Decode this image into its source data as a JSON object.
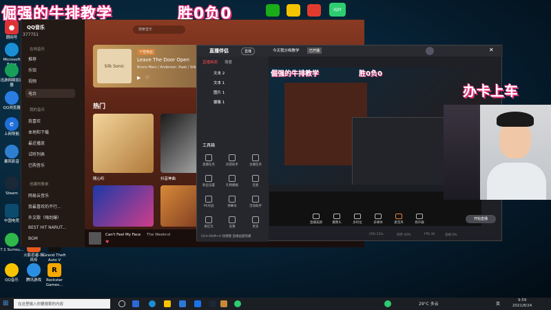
{
  "overlay": {
    "title_left": "倔强的牛排教学",
    "record": "胜0负0",
    "card_banner": "办卡上车"
  },
  "desktop_icons": [
    {
      "label": "朗网号",
      "sub": ""
    },
    {
      "label": "Microsoft Edge",
      "sub": ""
    },
    {
      "label": "迅游网络加速器",
      "sub": ""
    },
    {
      "label": "QQ浏览器",
      "sub": ""
    },
    {
      "label": "上网导航",
      "sub": ""
    },
    {
      "label": "暴风影音",
      "sub": ""
    },
    {
      "label": "Steam",
      "sub": ""
    },
    {
      "label": "中国电竞",
      "sub": ""
    },
    {
      "label": "7.1 Surrou...",
      "sub": ""
    },
    {
      "label": "QQ音乐",
      "sub": ""
    }
  ],
  "bottom_desktop_icons": [
    {
      "label": "火影忍者-疾风传"
    },
    {
      "label": "Grand Theft Auto V"
    },
    {
      "label": "Rockstar Games..."
    },
    {
      "label": "腾讯游戏"
    }
  ],
  "qqmusic": {
    "title": "QQ音乐",
    "user_id": "377751",
    "search_placeholder": "搜索音乐",
    "nav": [
      "推荐",
      "乐馆",
      "视频",
      "电台"
    ],
    "section_mine": "我的音乐",
    "mine_items": [
      "我喜欢",
      "本地和下载",
      "最近播放",
      "试听列表",
      "已购音乐"
    ],
    "section_playlists": "创建的歌单",
    "playlists": [
      "网易云音乐",
      "我最喜欢的不行...",
      "外文歌（嗨到爆）",
      "BEST HIT NARUT...",
      "BGM"
    ],
    "banner_tag": "个性电台",
    "banner_title": "Leave The Door Open",
    "banner_artist": "Bruno Mars / Anderson .Paak / Silk S...",
    "album_text": "Silk Sonic",
    "section_hot": "热门",
    "cards": [
      {
        "label": "随心听"
      },
      {
        "label": "抖音神曲"
      }
    ],
    "now_playing": "Can't Feel My Face",
    "now_artist": "The Weeknd"
  },
  "live": {
    "app_name": "直播伴侣",
    "mode": "直播",
    "scene_tab": "直播画面",
    "scene_tab2": "场景",
    "sources": [
      "文本 2",
      "文本 1",
      "图片 1",
      "摄像 1"
    ],
    "tools_title": "工具箱",
    "tools": [
      "直播任务",
      "房管助手",
      "主播任务",
      "粉丝设置",
      "礼物播报",
      "连麦",
      "PK对战",
      "弹幕号",
      "活动助手",
      "发红包",
      "竞猜",
      "更多"
    ],
    "room_title": "今天我分档教学",
    "room_tag": "已开播",
    "stat_viewers": "0",
    "stat_likes": "0",
    "bottom_controls": [
      "直播美颜",
      "摄像头",
      "多机位",
      "多媒体",
      "麦克风",
      "扬声器"
    ],
    "start_button": "开始直播",
    "footer_stats": [
      "CPU 21%",
      "内存 45%",
      "FPS 30",
      "丢帧 0%"
    ],
    "tip": "Ctrl+Shift+H 快捷键 直播画面隐藏"
  },
  "taskbar": {
    "search_placeholder": "在这里输入你要搜索的内容",
    "weather": "29°C 多云",
    "time": "9:59",
    "date": "2021/8/24",
    "lang": "英"
  }
}
